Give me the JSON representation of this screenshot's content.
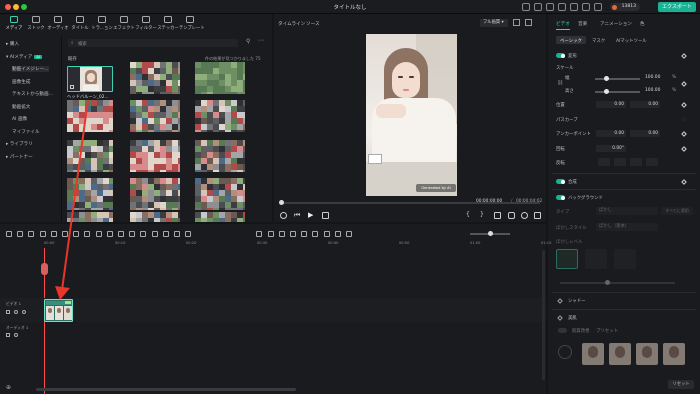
{
  "app": {
    "window_title": "タイトルなし",
    "export_label": "エクスポート",
    "credits": "13813"
  },
  "toolbar": [
    {
      "label": "メディア",
      "icon": "media-icon",
      "active": true
    },
    {
      "label": "ストック",
      "icon": "stock-icon"
    },
    {
      "label": "オーディオ",
      "icon": "audio-icon"
    },
    {
      "label": "タイトル",
      "icon": "title-icon"
    },
    {
      "label": "トラ...ョン",
      "icon": "transition-icon"
    },
    {
      "label": "エフェクト",
      "icon": "effect-icon"
    },
    {
      "label": "フィルター",
      "icon": "filter-icon"
    },
    {
      "label": "ステッカー",
      "icon": "sticker-icon"
    },
    {
      "label": "テンプレート",
      "icon": "template-icon"
    }
  ],
  "sidebar": {
    "items": [
      {
        "label": "▸ 購入"
      },
      {
        "label": "▾ AIメディア",
        "badge": "AI"
      },
      {
        "label": "動画イメジレー..."
      },
      {
        "label": "画像生成"
      },
      {
        "label": "テキストから動画..."
      },
      {
        "label": "動画拡大"
      },
      {
        "label": "AI 画像"
      },
      {
        "label": "マイファイル"
      },
      {
        "label": "▸ ライブラリ"
      },
      {
        "label": "▸ パートナー"
      }
    ]
  },
  "media": {
    "search_placeholder": "検索",
    "sort_label": "既存",
    "results_text": "件の結果が見つかりました 75",
    "selected_clip_label": "ヘッドバルーン_02..."
  },
  "preview": {
    "tabs": [
      "タイムライン",
      "ソース"
    ],
    "quality": "フル画質",
    "watermark": "Generated by AI",
    "current_time": "00:00:00:00",
    "total_time": "00:00:04:02",
    "time_sep": "/"
  },
  "inspector": {
    "tabs": [
      "ビデオ",
      "音楽",
      "アニメーション",
      "色"
    ],
    "subtabs": [
      "ベーシック",
      "マスク",
      "AIマットツール"
    ],
    "transform_label": "変形",
    "scale_label": "スケール",
    "width_label": "幅",
    "height_label": "高さ",
    "scale_w": "100.00",
    "scale_h": "100.00",
    "unit": "%",
    "position_label": "位置",
    "pos_x": "0.00",
    "pos_y": "0.00",
    "path_curve_label": "パスカーブ",
    "anchor_label": "アンカーポイント",
    "anchor_x": "0.00",
    "anchor_y": "0.00",
    "rotate_label": "回転",
    "rotate_val": "0.00°",
    "flip_label": "反転",
    "composite_label": "合成",
    "background_label": "バックグラウンド",
    "type_label": "タイプ",
    "type_val": "ぼかし",
    "apply_all": "すべてに適用",
    "blur_style_label": "ぼかしスタイル",
    "blur_style_val": "ぼかし（基本）",
    "blur_level_label": "ぼかしレベル",
    "shadow_label": "シャドー",
    "beauty_label": "美肌",
    "beauty_tab1": "肌質改善",
    "beauty_tab2": "プリセット",
    "reset_label": "リセット"
  },
  "timeline": {
    "ruler": [
      "00:00",
      "00:10",
      "00:20",
      "00:30",
      "00:40",
      "00:50",
      "01:00",
      "01:10"
    ],
    "tracks": [
      {
        "label": "ビデオ 1"
      },
      {
        "label": "オーディオ 1"
      }
    ]
  },
  "colors": {
    "accent": "#19b394",
    "arrow": "#e8362c",
    "playhead": "#ff4b4b"
  }
}
